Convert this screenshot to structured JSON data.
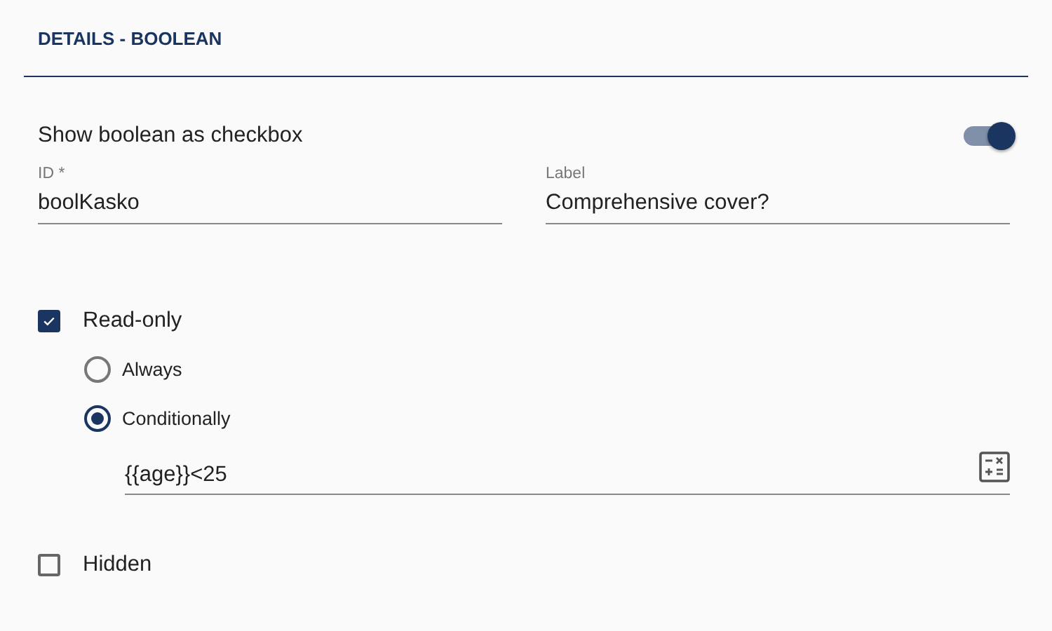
{
  "section": {
    "title": "DETAILS - BOOLEAN"
  },
  "toggle": {
    "label": "Show boolean as checkbox",
    "on": true
  },
  "fields": [
    {
      "label": "ID *",
      "value": "boolKasko"
    },
    {
      "label": "Label",
      "value": "Comprehensive cover?"
    }
  ],
  "read_only": {
    "label": "Read-only",
    "checked": true,
    "options": [
      {
        "label": "Always",
        "selected": false
      },
      {
        "label": "Conditionally",
        "selected": true
      }
    ],
    "condition": {
      "value": "{{age}}<25"
    }
  },
  "hidden": {
    "label": "Hidden",
    "checked": false
  }
}
